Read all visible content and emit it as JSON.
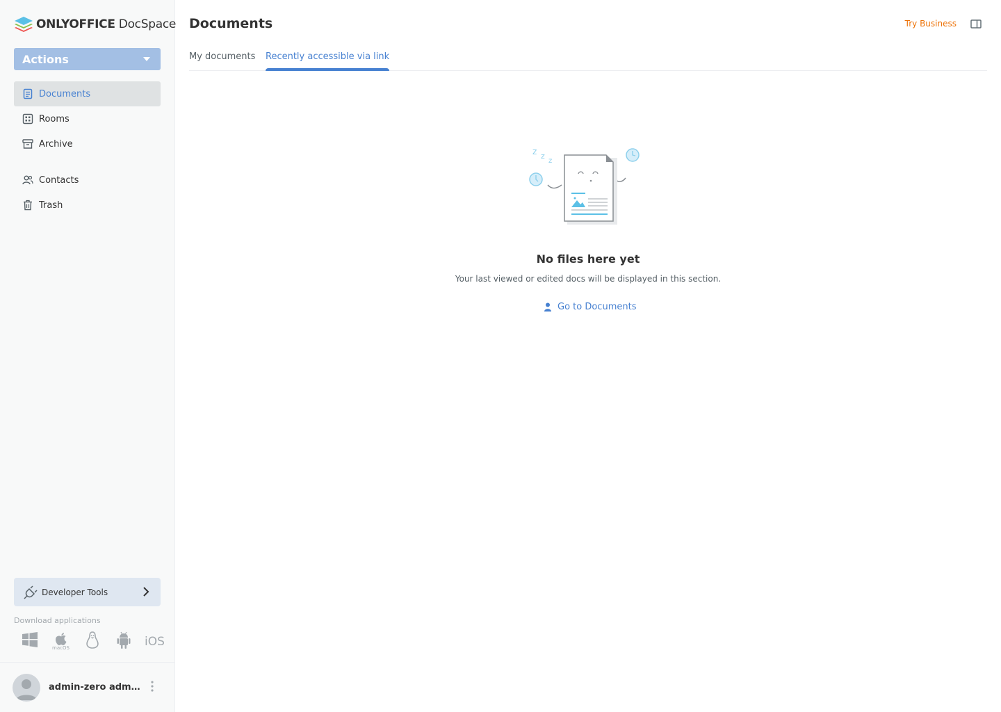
{
  "app": {
    "logo_brand": "ONLYOFFICE",
    "logo_product": "DocSpace"
  },
  "sidebar": {
    "actions_label": "Actions",
    "items": [
      {
        "label": "Documents",
        "icon": "document-icon",
        "active": true
      },
      {
        "label": "Rooms",
        "icon": "rooms-icon",
        "active": false
      },
      {
        "label": "Archive",
        "icon": "archive-icon",
        "active": false
      },
      {
        "label": "Contacts",
        "icon": "contacts-icon",
        "active": false
      },
      {
        "label": "Trash",
        "icon": "trash-icon",
        "active": false
      }
    ],
    "developer_tools_label": "Developer Tools",
    "download_label": "Download applications",
    "apps": [
      {
        "name": "windows-icon"
      },
      {
        "name": "macos-icon",
        "caption": "macOS"
      },
      {
        "name": "linux-icon"
      },
      {
        "name": "android-icon"
      },
      {
        "name": "ios-icon",
        "label": "iOS"
      }
    ],
    "user_name": "admin-zero admin-zero"
  },
  "header": {
    "title": "Documents",
    "try_business": "Try Business"
  },
  "tabs": [
    {
      "label": "My documents",
      "active": false
    },
    {
      "label": "Recently accessible via link",
      "active": true
    }
  ],
  "empty_state": {
    "title": "No files here yet",
    "description": "Your last viewed or edited docs will be displayed in this section.",
    "link_label": "Go to Documents"
  },
  "colors": {
    "accent": "#4781d1",
    "actions_button": "#a3bfe4",
    "try_business": "#ed7309",
    "sidebar_bg": "#f8f9f9",
    "active_nav_bg": "#dfe2e3"
  }
}
